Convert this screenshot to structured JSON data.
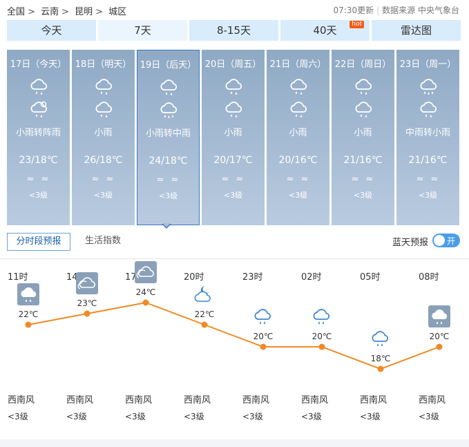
{
  "breadcrumb": [
    "全国",
    "云南",
    "昆明",
    "城区"
  ],
  "breadcrumb_sep": ">",
  "update_time": "07:30更新",
  "data_source": "数据来源 中央气象台",
  "tabs": [
    {
      "label": "今天"
    },
    {
      "label": "7天"
    },
    {
      "label": "8-15天"
    },
    {
      "label": "40天",
      "badge": "hot"
    },
    {
      "label": "雷达图"
    }
  ],
  "days": [
    {
      "label": "17日（今天）",
      "icon1": "light-rain-icon",
      "icon2": "shower-icon",
      "desc": "小雨转阵雨",
      "temp": "23/18℃",
      "wind": "≈≈",
      "level": "<3级"
    },
    {
      "label": "18日（明天）",
      "icon1": "light-rain-icon",
      "icon2": "light-rain-icon",
      "desc": "小雨",
      "temp": "26/18℃",
      "wind": "≈≈",
      "level": "<3级"
    },
    {
      "label": "19日（后天）",
      "icon1": "light-rain-icon",
      "icon2": "moderate-rain-icon",
      "desc": "小雨转中雨",
      "temp": "24/18℃",
      "wind": "≈≈",
      "level": "<3级"
    },
    {
      "label": "20日（周五）",
      "icon1": "light-rain-icon",
      "icon2": "light-rain-icon",
      "desc": "小雨",
      "temp": "20/17℃",
      "wind": "≈≈",
      "level": "<3级"
    },
    {
      "label": "21日（周六）",
      "icon1": "light-rain-icon",
      "icon2": "light-rain-icon",
      "desc": "小雨",
      "temp": "20/16℃",
      "wind": "≈≈",
      "level": "<3级"
    },
    {
      "label": "22日（周日）",
      "icon1": "light-rain-icon",
      "icon2": "light-rain-icon",
      "desc": "小雨",
      "temp": "21/16℃",
      "wind": "≈≈",
      "level": "<3级"
    },
    {
      "label": "23日（周一）",
      "icon1": "moderate-rain-icon",
      "icon2": "light-rain-icon",
      "desc": "中雨转小雨",
      "temp": "21/16℃",
      "wind": "≈≈",
      "level": "<3级"
    }
  ],
  "subtabs": [
    "分时段预报",
    "生活指数"
  ],
  "bluesky_label": "蓝天预报",
  "toggle_label": "开",
  "hourly": [
    {
      "time": "11时",
      "icon": "rain-cloud-icon",
      "temp": "22℃",
      "value": 22,
      "wind_dir": "西南风",
      "wind_level": "<3级"
    },
    {
      "time": "14时",
      "icon": "overcast-icon",
      "temp": "23℃",
      "value": 23,
      "wind_dir": "西南风",
      "wind_level": "<3级"
    },
    {
      "time": "17时",
      "icon": "overcast-icon",
      "temp": "24℃",
      "value": 24,
      "wind_dir": "西南风",
      "wind_level": "<3级"
    },
    {
      "time": "20时",
      "icon": "night-cloudy-icon",
      "temp": "22℃",
      "value": 22,
      "wind_dir": "西南风",
      "wind_level": "<3级"
    },
    {
      "time": "23时",
      "icon": "light-rain-icon",
      "temp": "20℃",
      "value": 20,
      "wind_dir": "西南风",
      "wind_level": "<3级"
    },
    {
      "time": "02时",
      "icon": "light-rain-icon",
      "temp": "20℃",
      "value": 20,
      "wind_dir": "西南风",
      "wind_level": "<3级"
    },
    {
      "time": "05时",
      "icon": "light-rain-icon",
      "temp": "18℃",
      "value": 18,
      "wind_dir": "西南风",
      "wind_level": "<3级"
    },
    {
      "time": "08时",
      "icon": "rain-cloud-icon",
      "temp": "20℃",
      "value": 20,
      "wind_dir": "西南风",
      "wind_level": "<3级"
    }
  ],
  "colors": {
    "tab_bg": "#d9ecfc",
    "day_card": "#9fb6cf",
    "curve": "#f08a24",
    "accent": "#4a9ee8"
  }
}
